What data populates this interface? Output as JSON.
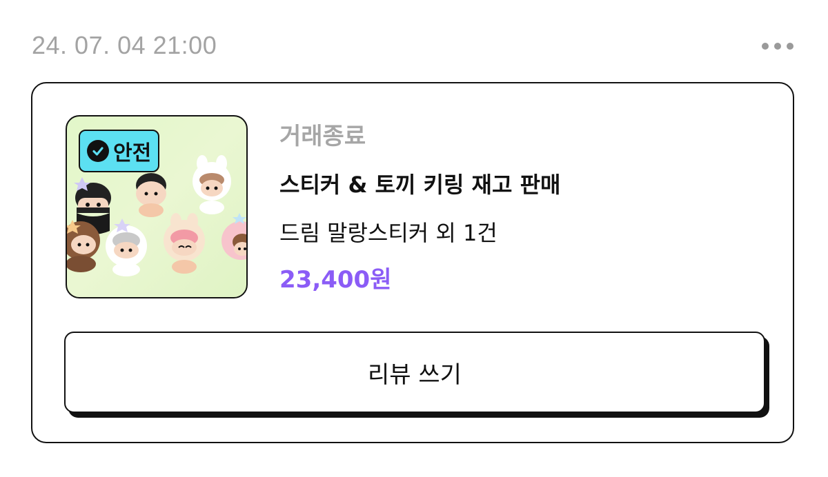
{
  "order": {
    "date": "24. 07. 04 21:00",
    "more_icon": "more-horizontal-icon",
    "status": "거래종료",
    "title": "스티커 & 토끼 키링 재고 판매",
    "items_summary": "드림 말랑스티커 외 1건",
    "price": "23,400원",
    "safe_badge": {
      "label": "안전",
      "icon": "check-circle-icon",
      "color": "#5ce0f2"
    },
    "price_color": "#8b5cf6"
  },
  "actions": {
    "review_label": "리뷰 쓰기"
  }
}
